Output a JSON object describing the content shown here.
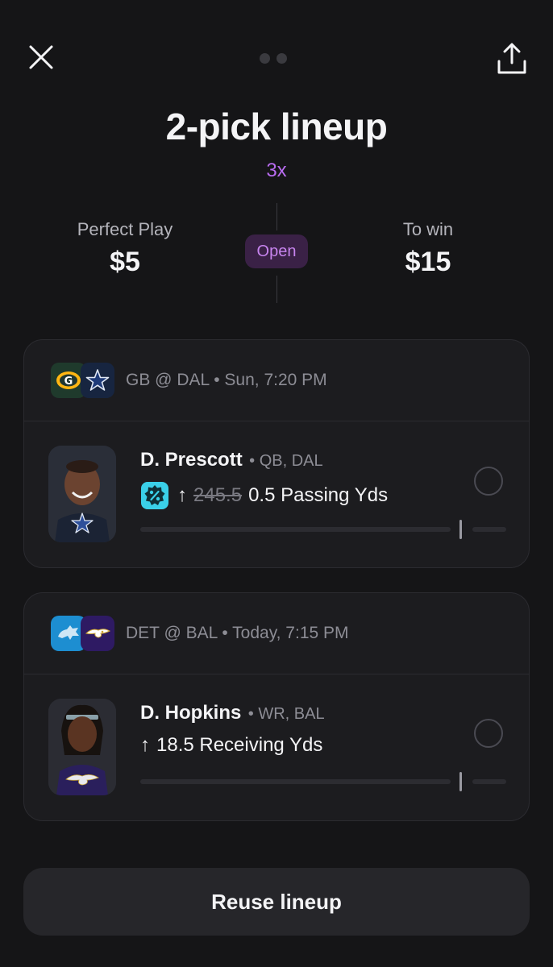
{
  "header": {
    "close_icon": "close-icon",
    "share_icon": "share-icon",
    "page_dots": 2
  },
  "lineup": {
    "title": "2-pick lineup",
    "multiplier": "3x"
  },
  "summary": {
    "left_label": "Perfect Play",
    "left_value": "$5",
    "status": "Open",
    "right_label": "To win",
    "right_value": "$15"
  },
  "picks": [
    {
      "game": "GB @ DAL • Sun, 7:20 PM",
      "team_logos": [
        "green-bay-logo",
        "dallas-logo"
      ],
      "player_name": "D. Prescott",
      "player_meta": "• QB, DAL",
      "direction_icon": "arrow-up-icon",
      "promo_icon": "discount-badge-icon",
      "old_line": "245.5",
      "prop": "0.5 Passing Yds",
      "headshot_team": "dallas-star"
    },
    {
      "game": "DET @ BAL • Today, 7:15 PM",
      "team_logos": [
        "detroit-logo",
        "baltimore-logo"
      ],
      "player_name": "D. Hopkins",
      "player_meta": "• WR, BAL",
      "direction_icon": "arrow-up-icon",
      "prop": "18.5 Receiving Yds",
      "headshot_team": "baltimore-raven"
    }
  ],
  "footer": {
    "reuse_label": "Reuse lineup"
  },
  "colors": {
    "background": "#151517",
    "card": "#1c1c1f",
    "accent_purple": "#b86cf0",
    "status_pill_bg": "#3a2146",
    "promo_cyan": "#3ad0e8"
  }
}
